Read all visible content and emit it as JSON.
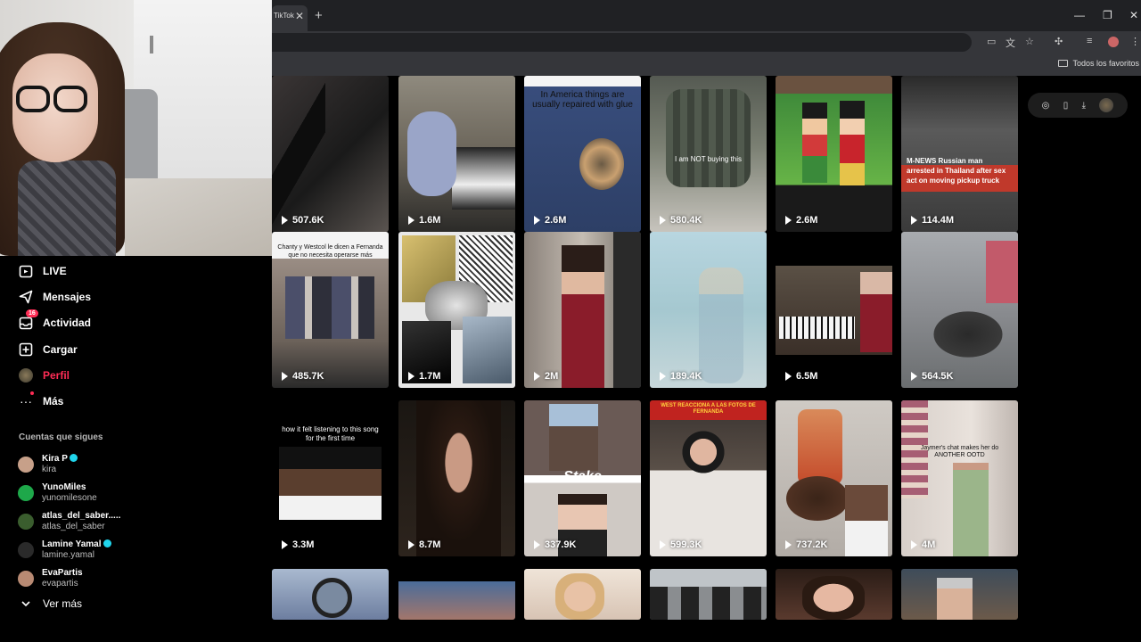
{
  "browser": {
    "tab_title": "TikTok",
    "new_tab_icon": "+",
    "bookmark_folder": "Todos los favoritos"
  },
  "sidebar": {
    "items": [
      {
        "label": "LIVE",
        "icon": "live-icon"
      },
      {
        "label": "Mensajes",
        "icon": "send-icon"
      },
      {
        "label": "Actividad",
        "icon": "inbox-icon",
        "badge": "16"
      },
      {
        "label": "Cargar",
        "icon": "upload-icon"
      },
      {
        "label": "Perfil",
        "icon": "avatar-icon"
      },
      {
        "label": "Más",
        "icon": "more-icon"
      }
    ],
    "following_title": "Cuentas que sigues",
    "following": [
      {
        "name": "Kira P",
        "user": "kira",
        "verified": true,
        "color": "#c7a089"
      },
      {
        "name": "YunoMiles",
        "user": "yunomilesone",
        "verified": false,
        "color": "#1ea84a"
      },
      {
        "name": "atlas_del_saber.....",
        "user": "atlas_del_saber",
        "verified": false,
        "color": "#3a5d2e"
      },
      {
        "name": "Lamine Yamal",
        "user": "lamine.yamal",
        "verified": true,
        "color": "#2a2a2a"
      },
      {
        "name": "EvaPartis",
        "user": "evapartis",
        "verified": false,
        "color": "#b88a73"
      }
    ],
    "see_more": "Ver más"
  },
  "grid": {
    "videos": [
      {
        "views": "507.6K",
        "caption": ""
      },
      {
        "views": "1.6M",
        "caption": ""
      },
      {
        "views": "2.6M",
        "caption": "In America things are usually repaired with glue"
      },
      {
        "views": "580.4K",
        "caption": "I am NOT buying this"
      },
      {
        "views": "2.6M",
        "caption": ""
      },
      {
        "views": "114.4M",
        "caption": "M-NEWS Russian man arrested in Thailand after sex act on moving pickup truck"
      },
      {
        "views": "485.7K",
        "caption": "Chanty y Westcol le dicen a Fernanda que no necesita operarse más"
      },
      {
        "views": "1.7M",
        "caption": ""
      },
      {
        "views": "2M",
        "caption": ""
      },
      {
        "views": "189.4K",
        "caption": ""
      },
      {
        "views": "6.5M",
        "caption": ""
      },
      {
        "views": "564.5K",
        "caption": ""
      },
      {
        "views": "3.3M",
        "caption": "how it felt listening to this song for the first time"
      },
      {
        "views": "8.7M",
        "caption": ""
      },
      {
        "views": "337.9K",
        "caption": "Stake"
      },
      {
        "views": "599.3K",
        "caption": "WEST REACCIONA A LAS FOTOS DE FERNANDA"
      },
      {
        "views": "737.2K",
        "caption": ""
      },
      {
        "views": "4M",
        "caption": "Jaymer's chat makes her do ANOTHER OOTD"
      },
      {
        "views": "",
        "caption": ""
      },
      {
        "views": "",
        "caption": ""
      },
      {
        "views": "",
        "caption": ""
      },
      {
        "views": "",
        "caption": ""
      },
      {
        "views": "",
        "caption": ""
      },
      {
        "views": "",
        "caption": ""
      }
    ]
  },
  "colors": {
    "accent": "#fe2c55",
    "verified": "#20d5ec"
  }
}
